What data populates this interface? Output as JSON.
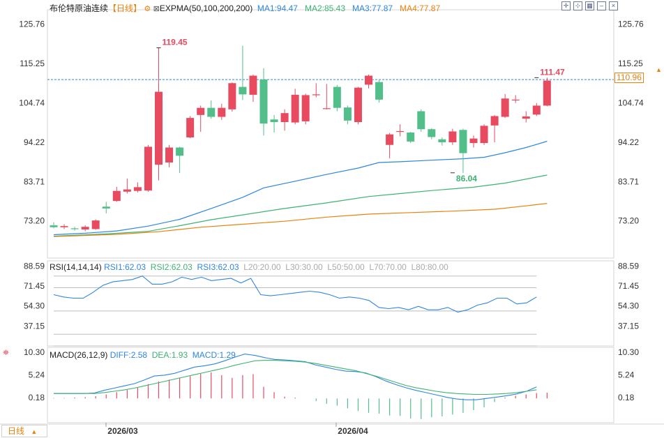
{
  "header": {
    "instrument": "布伦特原油连续",
    "period_tag": "【日线】",
    "main_indicator": "EXPMA(50,100,200,200)",
    "ma": [
      {
        "label": "MA1:94.47",
        "color": "#2e86de"
      },
      {
        "label": "MA2:85.43",
        "color": "#3cb371"
      },
      {
        "label": "MA3:77.87",
        "color": "#2e86de"
      },
      {
        "label": "MA4:77.87",
        "color": "#e8820c"
      }
    ]
  },
  "toolbar": {
    "icons": [
      "expand-icon",
      "collapse-icon",
      "grid-icon",
      "minimize-icon",
      "close-icon"
    ]
  },
  "current_price_tag": "110.96",
  "period_button": {
    "label": "日线",
    "arrow": "▲"
  },
  "colors": {
    "up": "#e84a5f",
    "down": "#52bf8a",
    "ma50": "#2e86de",
    "ma100": "#3cb371",
    "ma200": "#e8820c",
    "dif": "#2e86de",
    "dea": "#3cb371",
    "ref_line": "#2e86de",
    "label_up": "#e84a5f",
    "label_down": "#3cb371"
  },
  "x_labels": [
    "2026/03",
    "2026/04"
  ],
  "chart_data": [
    {
      "type": "candlestick",
      "yticks": [
        "125.76",
        "115.25",
        "104.74",
        "94.22",
        "83.71",
        "73.20"
      ],
      "ylim": [
        64.0,
        128.5
      ],
      "current_price": 110.96,
      "annotations": [
        {
          "label": "119.45",
          "value": 119.45,
          "kind": "high",
          "candle": 10
        },
        {
          "label": "111.47",
          "value": 111.47,
          "kind": "high",
          "candle": 46
        },
        {
          "label": "86.04",
          "value": 86.04,
          "kind": "low",
          "candle": 38
        }
      ],
      "candles": [
        [
          72.0,
          71.5,
          72.8,
          71.2
        ],
        [
          71.5,
          71.8,
          72.3,
          71.0
        ],
        [
          71.2,
          71.0,
          71.6,
          70.6
        ],
        [
          70.9,
          71.6,
          72.0,
          70.4
        ],
        [
          71.0,
          73.3,
          73.6,
          70.8
        ],
        [
          77.0,
          76.5,
          78.3,
          75.2
        ],
        [
          78.5,
          81.2,
          82.3,
          78.3
        ],
        [
          81.0,
          81.6,
          84.5,
          80.5
        ],
        [
          81.2,
          82.2,
          83.5,
          80.8
        ],
        [
          81.3,
          93.0,
          93.5,
          81.0
        ],
        [
          88.2,
          107.7,
          119.45,
          84.0
        ],
        [
          88.8,
          92.8,
          93.5,
          87.5
        ],
        [
          92.8,
          90.6,
          93.0,
          86.0
        ],
        [
          95.5,
          100.7,
          101.2,
          95.3
        ],
        [
          101.5,
          103.4,
          104.0,
          97.0
        ],
        [
          103.4,
          101.0,
          105.4,
          100.5
        ],
        [
          101.0,
          103.4,
          104.5,
          100.2
        ],
        [
          103.0,
          110.0,
          110.2,
          102.4
        ],
        [
          109.0,
          107.0,
          120.0,
          105.5
        ],
        [
          106.9,
          112.0,
          112.3,
          105.0
        ],
        [
          111.0,
          99.2,
          114.0,
          96.0
        ],
        [
          100.3,
          99.6,
          101.5,
          96.8
        ],
        [
          99.6,
          102.0,
          103.0,
          97.3
        ],
        [
          99.5,
          106.9,
          108.5,
          99.0
        ],
        [
          99.8,
          106.8,
          107.2,
          99.0
        ],
        [
          107.0,
          107.0,
          110.0,
          106.2
        ],
        [
          103.3,
          103.3,
          109.8,
          103.0
        ],
        [
          109.0,
          103.4,
          109.5,
          102.5
        ],
        [
          103.5,
          100.0,
          104.0,
          99.0
        ],
        [
          99.6,
          108.8,
          109.0,
          99.0
        ],
        [
          109.6,
          112.0,
          112.3,
          108.6
        ],
        [
          110.3,
          105.6,
          110.8,
          104.8
        ],
        [
          93.5,
          96.3,
          96.7,
          89.9
        ],
        [
          97.2,
          97.2,
          99.0,
          95.8
        ],
        [
          96.8,
          94.4,
          97.0,
          94.0
        ],
        [
          102.5,
          97.7,
          103.0,
          97.0
        ],
        [
          97.7,
          95.6,
          98.0,
          95.0
        ],
        [
          95.0,
          94.2,
          95.5,
          93.3
        ],
        [
          94.2,
          97.1,
          97.8,
          93.5
        ],
        [
          97.5,
          91.3,
          97.8,
          86.04
        ],
        [
          94.0,
          95.2,
          96.0,
          92.8
        ],
        [
          94.0,
          98.6,
          99.0,
          93.5
        ],
        [
          98.7,
          101.2,
          101.5,
          94.2
        ],
        [
          101.0,
          105.9,
          107.1,
          100.7
        ],
        [
          105.6,
          105.6,
          106.8,
          104.7
        ],
        [
          100.5,
          101.1,
          102.5,
          99.5
        ],
        [
          101.6,
          104.0,
          104.7,
          101.2
        ],
        [
          104.0,
          110.7,
          111.47,
          103.8
        ]
      ],
      "series": [
        {
          "name": "EXPMA50",
          "color": "#2e86de",
          "points": [
            [
              0,
              69.5
            ],
            [
              3,
              69.9
            ],
            [
              6,
              70.5
            ],
            [
              9,
              71.8
            ],
            [
              12,
              73.6
            ],
            [
              15,
              76.5
            ],
            [
              18,
              79.5
            ],
            [
              20,
              82.0
            ],
            [
              23,
              83.8
            ],
            [
              26,
              85.6
            ],
            [
              29,
              87.3
            ],
            [
              31,
              88.8
            ],
            [
              33,
              89.0
            ],
            [
              36,
              89.4
            ],
            [
              39,
              89.8
            ],
            [
              41,
              90.2
            ],
            [
              43,
              91.4
            ],
            [
              45,
              92.8
            ],
            [
              47,
              94.47
            ]
          ]
        },
        {
          "name": "EXPMA100",
          "color": "#3cb371",
          "points": [
            [
              0,
              69.1
            ],
            [
              5,
              69.7
            ],
            [
              9,
              70.4
            ],
            [
              12,
              71.9
            ],
            [
              15,
              73.5
            ],
            [
              18,
              74.8
            ],
            [
              22,
              76.5
            ],
            [
              26,
              78.0
            ],
            [
              30,
              79.7
            ],
            [
              33,
              80.5
            ],
            [
              36,
              81.3
            ],
            [
              40,
              82.2
            ],
            [
              43,
              83.3
            ],
            [
              47,
              85.43
            ]
          ]
        },
        {
          "name": "EXPMA200",
          "color": "#e8820c",
          "points": [
            [
              0,
              69.0
            ],
            [
              6,
              69.6
            ],
            [
              10,
              70.3
            ],
            [
              14,
              71.5
            ],
            [
              18,
              72.3
            ],
            [
              22,
              73.1
            ],
            [
              26,
              74.2
            ],
            [
              30,
              75.0
            ],
            [
              34,
              75.4
            ],
            [
              38,
              75.8
            ],
            [
              42,
              76.3
            ],
            [
              45,
              77.2
            ],
            [
              47,
              77.87
            ]
          ]
        }
      ]
    },
    {
      "type": "line",
      "title": "RSI(14,14,14)",
      "legend": [
        "RSI1:62.03",
        "RSI2:62.03",
        "RSI3:62.03",
        "L20:20.00",
        "L30:30.00",
        "L50:50.00",
        "L70:70.00",
        "L80:80.00"
      ],
      "yticks": [
        "88.59",
        "71.45",
        "54.30",
        "37.15"
      ],
      "ylim": [
        20,
        93
      ],
      "levels": [
        80,
        70,
        50,
        30,
        20
      ],
      "rsi": [
        64,
        62,
        61,
        61,
        66,
        72,
        75,
        76,
        77,
        80,
        73,
        73,
        75,
        79,
        77,
        79,
        76,
        77,
        78,
        74,
        78,
        64,
        63,
        64,
        65,
        66,
        67,
        66,
        64,
        61,
        62,
        61,
        59,
        53,
        52,
        53,
        51,
        54,
        51,
        51,
        53,
        49,
        51,
        55,
        57,
        61,
        61,
        56,
        57,
        62
      ]
    },
    {
      "type": "macd",
      "title": "MACD(26,12,9)",
      "legend": [
        "DIFF:2.58",
        "DEA:1.93",
        "MACD:1.29"
      ],
      "yticks": [
        "10.30",
        "5.24",
        "0.18"
      ],
      "ylim": [
        -5.4,
        11.4
      ],
      "dif": [
        1.1,
        1.1,
        1.1,
        1.1,
        1.2,
        1.8,
        2.3,
        2.8,
        3.3,
        4.1,
        5.0,
        5.2,
        5.6,
        6.3,
        7.0,
        7.3,
        7.7,
        8.4,
        9.2,
        9.9,
        9.6,
        9.1,
        8.7,
        8.6,
        8.4,
        8.2,
        7.5,
        7.0,
        6.5,
        6.1,
        6.0,
        5.7,
        4.9,
        3.9,
        3.1,
        2.4,
        1.8,
        1.3,
        0.8,
        0.3,
        -0.1,
        -0.3,
        -0.3,
        0.0,
        0.3,
        0.6,
        1.0,
        1.6,
        2.58
      ],
      "dea": [
        1.1,
        1.1,
        1.1,
        1.1,
        1.1,
        1.3,
        1.6,
        1.9,
        2.3,
        2.8,
        3.3,
        3.8,
        4.3,
        4.8,
        5.3,
        5.8,
        6.3,
        6.8,
        7.4,
        7.9,
        8.4,
        8.5,
        8.5,
        8.4,
        8.3,
        8.1,
        7.8,
        7.4,
        7.0,
        6.6,
        6.2,
        5.6,
        5.0,
        4.3,
        3.6,
        2.9,
        2.4,
        2.0,
        1.6,
        1.3,
        1.1,
        1.0,
        0.9,
        0.9,
        1.0,
        1.1,
        1.3,
        1.6,
        1.93
      ],
      "hist": [
        0.1,
        0.1,
        0.2,
        0.3,
        0.5,
        0.9,
        1.4,
        1.9,
        2.4,
        3.2,
        3.8,
        4.2,
        4.6,
        5.0,
        5.5,
        5.8,
        5.2,
        4.6,
        5.2,
        5.4,
        2.6,
        1.4,
        0.4,
        0.2,
        0.0,
        -0.6,
        -1.2,
        -1.6,
        -2.2,
        -2.8,
        -3.2,
        -3.4,
        -3.8,
        -3.9,
        -4.5,
        -4.6,
        -4.2,
        -4.0,
        -3.6,
        -3.2,
        -2.6,
        -2.0,
        -0.8,
        0.2,
        0.6,
        0.9,
        1.2,
        1.29
      ]
    }
  ]
}
